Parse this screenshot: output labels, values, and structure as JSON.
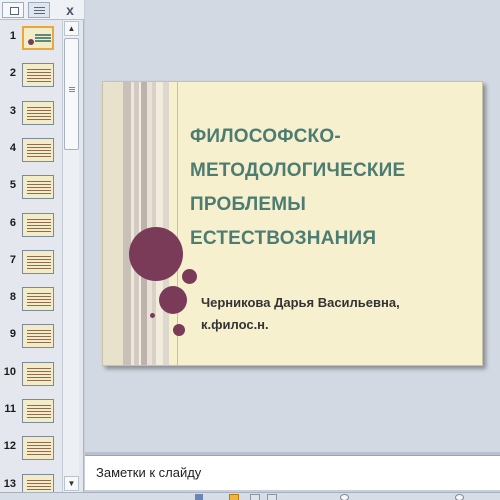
{
  "left_pane": {
    "close_label": "x",
    "thumbnails": [
      {
        "number": "1",
        "selected": true
      },
      {
        "number": "2",
        "selected": false
      },
      {
        "number": "3",
        "selected": false
      },
      {
        "number": "4",
        "selected": false
      },
      {
        "number": "5",
        "selected": false
      },
      {
        "number": "6",
        "selected": false
      },
      {
        "number": "7",
        "selected": false
      },
      {
        "number": "8",
        "selected": false
      },
      {
        "number": "9",
        "selected": false
      },
      {
        "number": "10",
        "selected": false
      },
      {
        "number": "11",
        "selected": false
      },
      {
        "number": "12",
        "selected": false
      },
      {
        "number": "13",
        "selected": false
      }
    ]
  },
  "slide": {
    "title_lines": [
      "Философско-",
      "методологические",
      "проблемы",
      "естествознания"
    ],
    "author_lines": [
      "Черникова Дарья Васильевна,",
      "к.филос.н."
    ],
    "colors": {
      "title": "#4d7d72",
      "circles": "#7a3b59",
      "background": "#f6f0cf"
    }
  },
  "notes": {
    "placeholder": "Заметки к слайду"
  }
}
